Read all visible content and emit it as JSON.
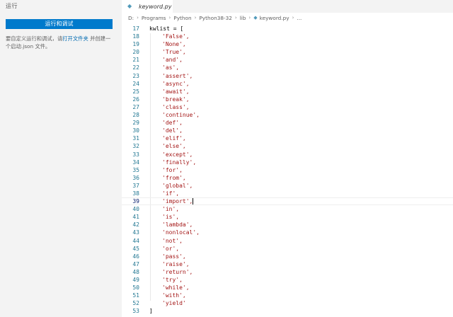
{
  "sidebar": {
    "title": "运行",
    "run_button": "运行和调试",
    "description_before": "要自定义运行和调试，请",
    "description_link": "打开文件夹",
    "description_after": " 并创建一个启动.json 文件。"
  },
  "tab": {
    "label": "keyword.py",
    "icon": "python-file-icon"
  },
  "breadcrumb": {
    "items": [
      "D:",
      "Programs",
      "Python",
      "Python38-32",
      "lib"
    ],
    "file": "keyword.py",
    "ellipsis": "..."
  },
  "editor": {
    "active_line": 39,
    "lines": [
      {
        "n": "17",
        "text": "kwlist = ["
      },
      {
        "n": "18",
        "text": "'False',"
      },
      {
        "n": "19",
        "text": "'None',"
      },
      {
        "n": "20",
        "text": "'True',"
      },
      {
        "n": "21",
        "text": "'and',"
      },
      {
        "n": "22",
        "text": "'as',"
      },
      {
        "n": "23",
        "text": "'assert',"
      },
      {
        "n": "24",
        "text": "'async',"
      },
      {
        "n": "25",
        "text": "'await',"
      },
      {
        "n": "26",
        "text": "'break',"
      },
      {
        "n": "27",
        "text": "'class',"
      },
      {
        "n": "28",
        "text": "'continue',"
      },
      {
        "n": "29",
        "text": "'def',"
      },
      {
        "n": "30",
        "text": "'del',"
      },
      {
        "n": "31",
        "text": "'elif',"
      },
      {
        "n": "32",
        "text": "'else',"
      },
      {
        "n": "33",
        "text": "'except',"
      },
      {
        "n": "34",
        "text": "'finally',"
      },
      {
        "n": "35",
        "text": "'for',"
      },
      {
        "n": "36",
        "text": "'from',"
      },
      {
        "n": "37",
        "text": "'global',"
      },
      {
        "n": "38",
        "text": "'if',"
      },
      {
        "n": "39",
        "text": "'import',"
      },
      {
        "n": "40",
        "text": "'in',"
      },
      {
        "n": "41",
        "text": "'is',"
      },
      {
        "n": "42",
        "text": "'lambda',"
      },
      {
        "n": "43",
        "text": "'nonlocal',"
      },
      {
        "n": "44",
        "text": "'not',"
      },
      {
        "n": "45",
        "text": "'or',"
      },
      {
        "n": "46",
        "text": "'pass',"
      },
      {
        "n": "47",
        "text": "'raise',"
      },
      {
        "n": "48",
        "text": "'return',"
      },
      {
        "n": "49",
        "text": "'try',"
      },
      {
        "n": "50",
        "text": "'while',"
      },
      {
        "n": "51",
        "text": "'with',"
      },
      {
        "n": "52",
        "text": "'yield'"
      },
      {
        "n": "53",
        "text": "]"
      }
    ]
  },
  "colors": {
    "accent": "#007acc",
    "string": "#a31515",
    "line_number": "#237893",
    "bracket": "#0431fa"
  }
}
